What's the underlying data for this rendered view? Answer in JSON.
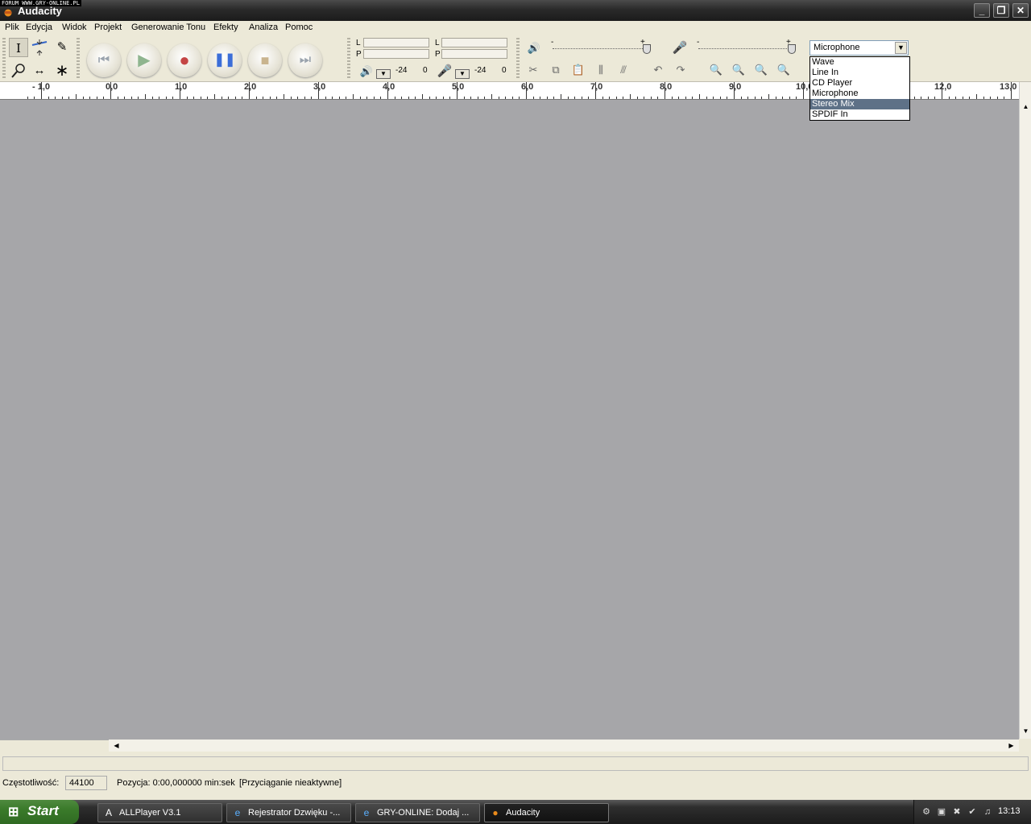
{
  "watermark": "FORUM WWW.GRY-ONLINE.PL",
  "window": {
    "title": "Audacity"
  },
  "menu": [
    "Plik",
    "Edycja",
    "Widok",
    "Projekt",
    "Generowanie Tonu",
    "Efekty",
    "Analiza",
    "Pomoc"
  ],
  "meters": {
    "channel_left": "L",
    "channel_right": "P",
    "play_scale": [
      "-24",
      "0"
    ],
    "rec_scale": [
      "-24",
      "0"
    ]
  },
  "sliders": {
    "minus": "-",
    "plus": "+"
  },
  "ruler": {
    "labels": [
      "- 1,0",
      "0,0",
      "1,0",
      "2,0",
      "3,0",
      "4,0",
      "5,0",
      "6,0",
      "7,0",
      "8,0",
      "9,0",
      "10,0",
      "12,0",
      "13,0"
    ]
  },
  "input_device": {
    "selected": "Microphone",
    "options": [
      "Wave",
      "Line In",
      "CD Player",
      "Microphone",
      "Stereo Mix",
      "SPDIF In"
    ],
    "highlighted_index": 4
  },
  "status": {
    "rate_label": "Częstotliwość:",
    "rate_value": "44100",
    "position_text": "Pozycja: 0:00,000000 min:sek",
    "snap_text": "[Przyciąganie nieaktywne]"
  },
  "taskbar": {
    "start": "Start",
    "tasks": [
      "ALLPlayer V3.1",
      "Rejestrator Dzwięku -...",
      "GRY-ONLINE: Dodaj ...",
      "Audacity"
    ],
    "active_index": 3,
    "clock": "13:13"
  },
  "colors": {
    "track_bg": "#a6a6a9",
    "highlight": "#5e7187",
    "record": "#c44545",
    "pause": "#3c6ed8",
    "play": "#8fb58f"
  },
  "icons": [
    "audacity-icon",
    "select-tool-icon",
    "envelope-tool-icon",
    "draw-tool-icon",
    "zoom-tool-icon",
    "timeshift-tool-icon",
    "multi-tool-icon",
    "skip-start-icon",
    "play-icon",
    "record-icon",
    "pause-icon",
    "stop-icon",
    "skip-end-icon",
    "speaker-icon",
    "microphone-icon",
    "cut-icon",
    "copy-icon",
    "paste-icon",
    "trim-icon",
    "silence-icon",
    "undo-icon",
    "redo-icon",
    "zoom-in-icon",
    "zoom-out-icon",
    "fit-selection-icon",
    "fit-project-icon"
  ]
}
